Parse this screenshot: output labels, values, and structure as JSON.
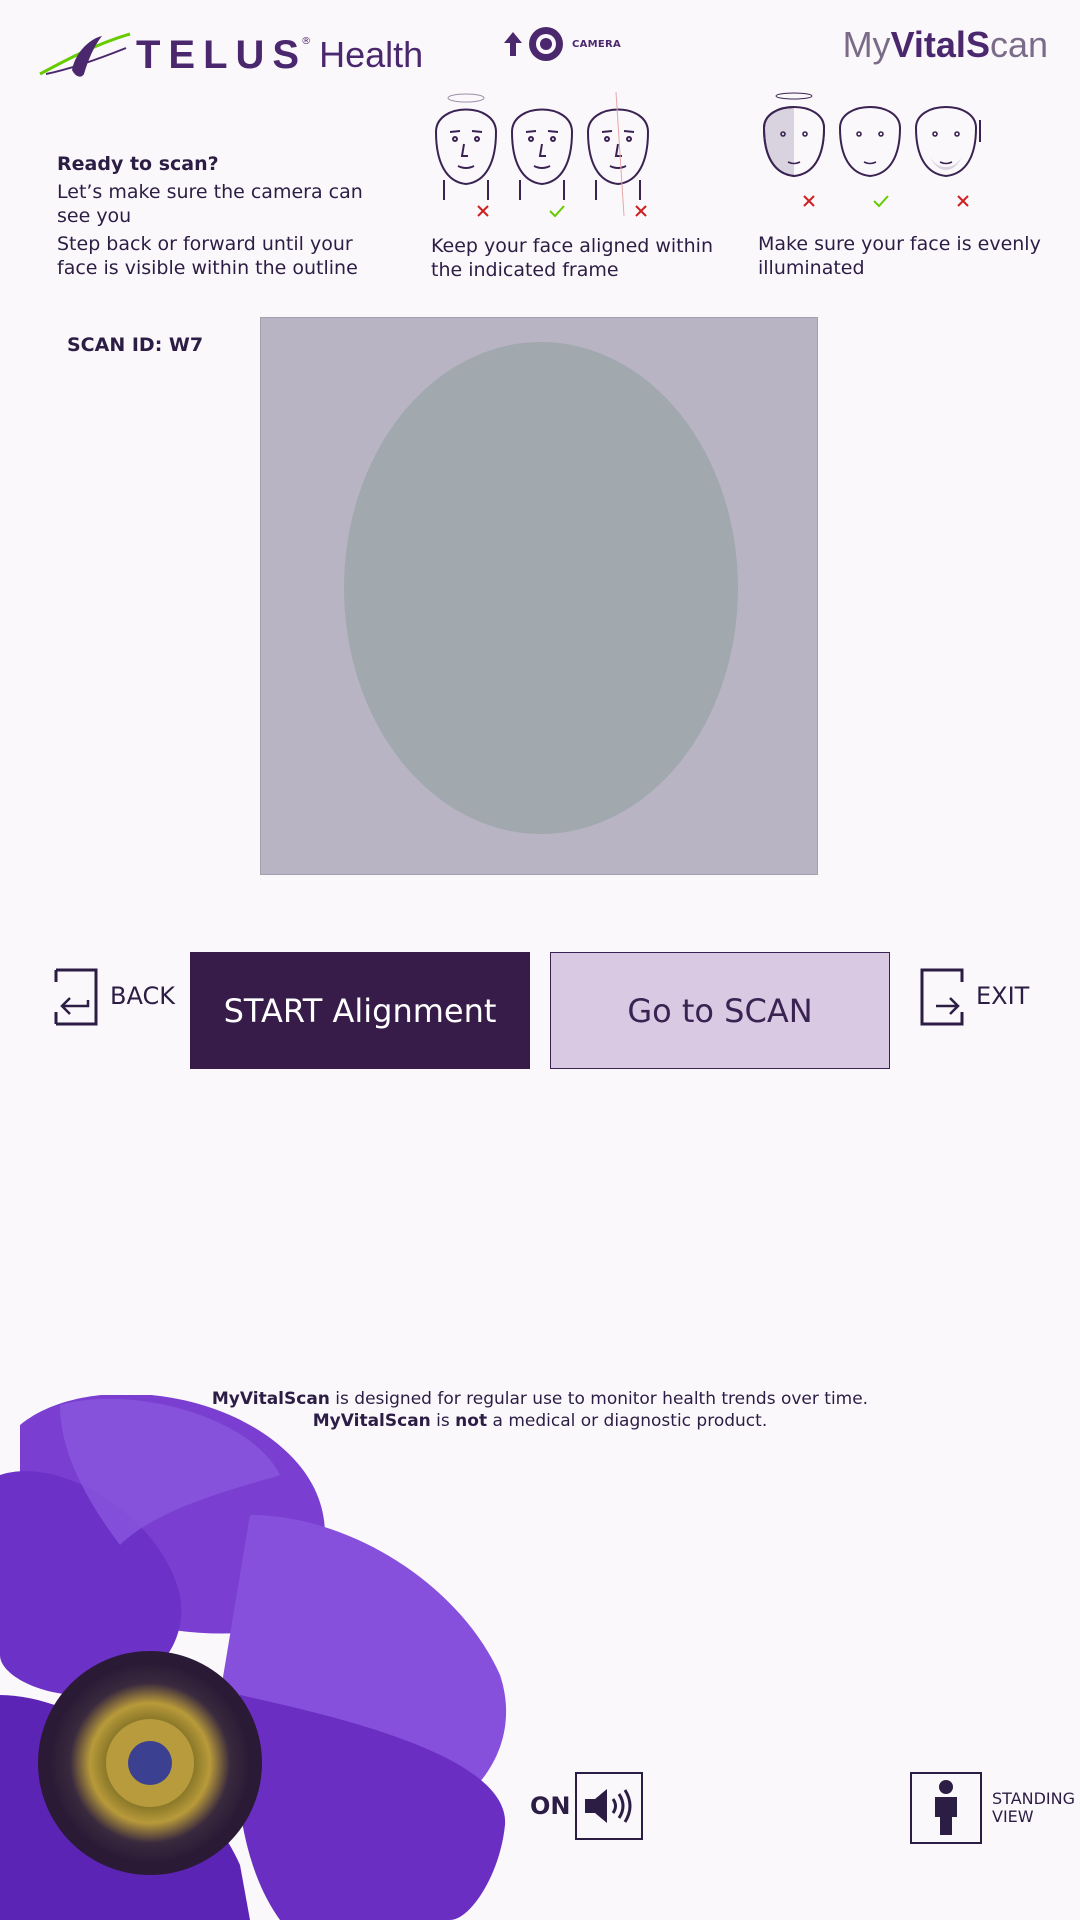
{
  "header": {
    "logo_telus": "TELUS",
    "logo_health": "Health",
    "camera_label": "CAMERA",
    "brand_prefix": "My",
    "brand_bold": "VitalS",
    "brand_suffix": "can"
  },
  "instructions": {
    "title": "Ready to scan?",
    "line1": "Let’s make sure the camera can see you",
    "line2": "Step back or forward until your face is visible within the outline"
  },
  "tips": {
    "alignment": "Keep your face aligned within the indicated frame",
    "lighting": "Make sure your face is evenly illuminated"
  },
  "scan_id": "SCAN ID: W7",
  "buttons": {
    "back": "BACK",
    "start": "START Alignment",
    "scan": "Go to SCAN",
    "exit": "EXIT"
  },
  "disclaimer": {
    "brand": "MyVitalScan",
    "part1": " is designed for regular use to monitor health trends over time. ",
    "part2": " is ",
    "not": "not",
    "part3": " a medical or diagnostic product."
  },
  "sound": {
    "label": "ON"
  },
  "view": {
    "label": "STANDING VIEW"
  },
  "colors": {
    "accent": "#4b286d",
    "dark_button": "#371c4a",
    "light_button": "#d9c9e2",
    "logo_green": "#66cc00"
  }
}
